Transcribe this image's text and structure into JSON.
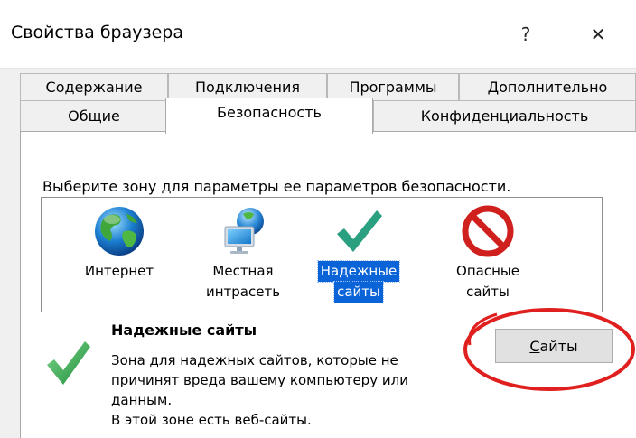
{
  "window": {
    "title": "Свойства браузера",
    "help_label": "?",
    "close_label": "✕"
  },
  "tabs": {
    "row1": [
      "Содержание",
      "Подключения",
      "Программы",
      "Дополнительно"
    ],
    "row2": [
      "Общие",
      "Безопасность",
      "Конфиденциальность"
    ],
    "active": "Безопасность"
  },
  "security": {
    "instruction": "Выберите зону для параметры ее параметров безопасности.",
    "zones": [
      {
        "label_line1": "Интернет",
        "label_line2": "",
        "icon": "globe-icon"
      },
      {
        "label_line1": "Местная",
        "label_line2": "интрасеть",
        "icon": "intranet-icon"
      },
      {
        "label_line1": "Надежные",
        "label_line2": "сайты",
        "icon": "checkmark-icon",
        "selected": true
      },
      {
        "label_line1": "Опасные",
        "label_line2": "сайты",
        "icon": "prohibited-icon"
      }
    ],
    "selected_zone": {
      "title": "Надежные сайты",
      "description_line1": "Зона для надежных сайтов, которые не",
      "description_line2": "причинят вреда вашему компьютеру или",
      "description_line3": "данным.",
      "description_line4": "В этой зоне есть веб-сайты."
    },
    "sites_button": {
      "accel": "С",
      "rest": "айты"
    }
  },
  "colors": {
    "selection": "#0a64d8",
    "annotation_circle": "#e0201e",
    "check_green": "#2e9c54"
  }
}
